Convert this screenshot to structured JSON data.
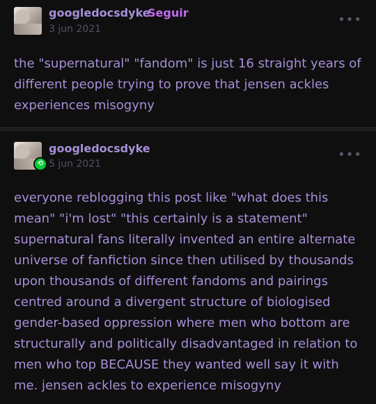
{
  "posts": [
    {
      "username": "googledocsdyke",
      "follow_label": "Seguir",
      "date": "3 jun 2021",
      "more_icon": "ellipsis-icon",
      "body": "the \"supernatural\" \"fandom\" is just 16 straight years of different people trying to prove that jensen ackles experiences misogyny"
    },
    {
      "username": "googledocsdyke",
      "date": "5 jun 2021",
      "badge_icon": "reblog-icon",
      "more_icon": "ellipsis-icon",
      "body": "everyone reblogging this post like \"what does this mean\" \"i'm lost\" \"this certainly is a statement\" supernatural fans literally invented an entire alternate universe of fanfiction since then utilised by thousands upon thousands of different fandoms and pairings centred around a divergent structure of biologised gender-based oppression where men who bottom are structurally and politically disadvantaged in relation to men who top BECAUSE they wanted well say it with me. jensen ackles to experience misogyny"
    }
  ],
  "colors": {
    "background": "#0f0f0f",
    "text": "#a78fd8",
    "follow": "#c06bf0",
    "date": "#564f69",
    "reblog_badge": "#00cf35"
  }
}
